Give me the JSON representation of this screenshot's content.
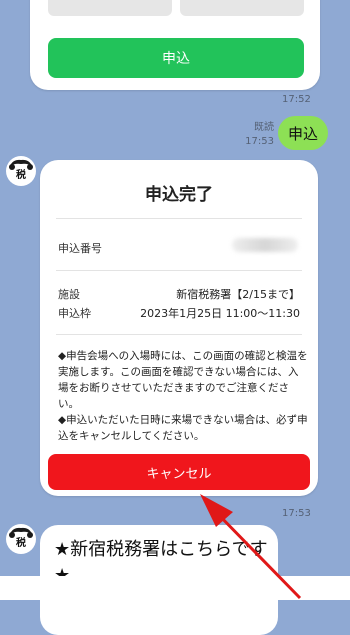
{
  "top_message": {
    "button_label": "申込",
    "time": "17:52"
  },
  "user_message": {
    "read_label": "既読",
    "time": "17:53",
    "text": "申込"
  },
  "bot_avatar": {
    "text": "税"
  },
  "confirmation_card": {
    "title": "申込完了",
    "application_number_label": "申込番号",
    "facility_label": "施設",
    "facility_value": "新宿税務署【2/15まで】",
    "slot_label": "申込枠",
    "slot_value": "2023年1月25日 11:00～11:30",
    "notice_1": "◆申告会場への入場時には、この画面の確認と検温を実施します。この画面を確認できない場合には、入場をお断りさせていただきますのでご注意ください。",
    "notice_2": "◆申込いただいた日時に来場できない場合は、必ず申込をキャンセルしてください。",
    "cancel_button": "キャンセル",
    "time": "17:53"
  },
  "bottom_message": {
    "text": "★新宿税務署はこちらです★"
  },
  "colors": {
    "chat_bg": "#8fa9d3",
    "green_button": "#22c35a",
    "user_bubble": "#8de055",
    "cancel_button": "#f0161c",
    "arrow": "#e01818"
  }
}
